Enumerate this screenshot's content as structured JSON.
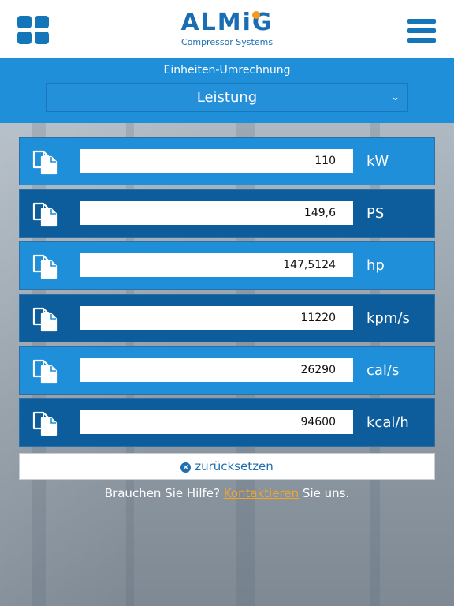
{
  "header": {
    "logo_text": "ALMiG",
    "logo_subtitle": "Compressor Systems"
  },
  "converter": {
    "label": "Einheiten-Umrechnung",
    "selected_quantity": "Leistung",
    "rows": [
      {
        "value": "110",
        "unit": "kW"
      },
      {
        "value": "149,6",
        "unit": "PS"
      },
      {
        "value": "147,5124",
        "unit": "hp"
      },
      {
        "value": "11220",
        "unit": "kpm/s"
      },
      {
        "value": "26290",
        "unit": "cal/s"
      },
      {
        "value": "94600",
        "unit": "kcal/h"
      }
    ],
    "reset_label": "zurücksetzen"
  },
  "help": {
    "text_before": "Brauchen Sie Hilfe?",
    "link": "Kontaktieren",
    "text_after": "Sie uns."
  },
  "colors": {
    "brand_blue": "#1476b8",
    "band_blue": "#1f8fd9",
    "row_dark": "#0d5d9c",
    "accent_orange": "#f29b1c"
  },
  "icons": [
    "apps-grid-icon",
    "menu-icon",
    "copy-icon",
    "chevron-down-icon",
    "close-circle-icon"
  ]
}
